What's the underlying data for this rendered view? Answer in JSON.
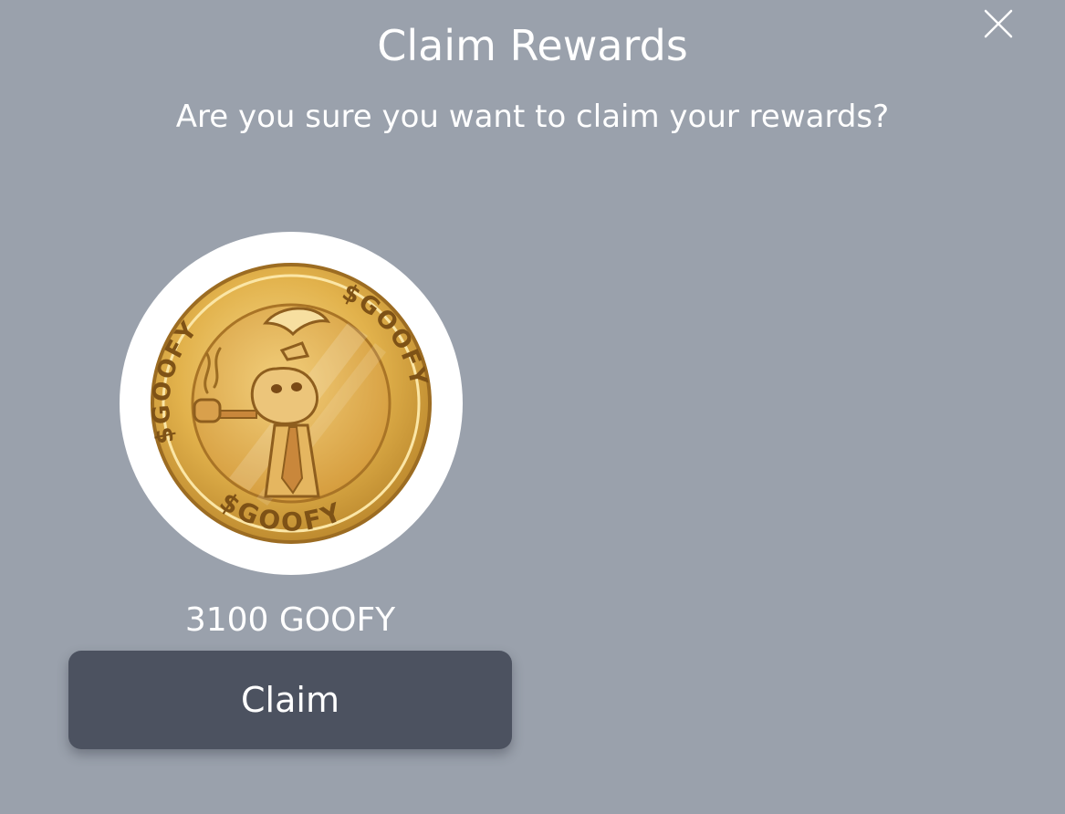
{
  "dialog": {
    "title": "Claim Rewards",
    "subtitle": "Are you sure you want to claim your rewards?",
    "close_icon": "close-icon"
  },
  "reward": {
    "token_icon": "goofy-coin-logo",
    "coin_text_top_left": "$GOOFY",
    "coin_text_top_right": "$GOOFY",
    "coin_text_bottom": "$GOOFY",
    "amount": "3100 GOOFY",
    "claim_label": "Claim"
  },
  "colors": {
    "background": "#9aa1ac",
    "button": "#4c5260",
    "text": "#ffffff",
    "coin_gold": "#e0b24a"
  }
}
